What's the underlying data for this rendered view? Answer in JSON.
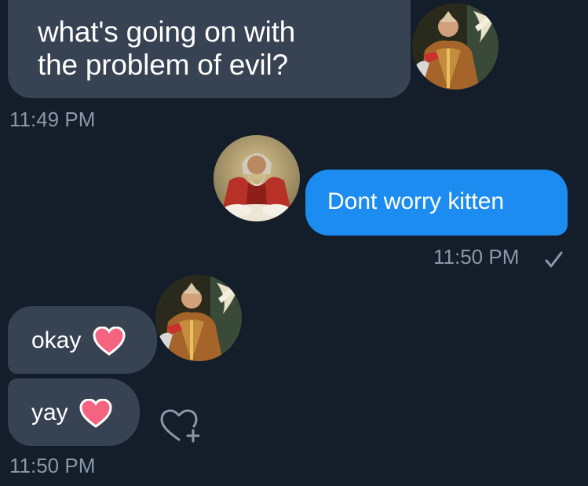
{
  "messages": [
    {
      "id": "m1",
      "side": "received",
      "lines": [
        "what's going on with",
        "the problem of evil?"
      ],
      "timestamp": "11:49 PM"
    },
    {
      "id": "m2",
      "side": "sent",
      "text": "Dont worry kitten",
      "timestamp": "11:50 PM",
      "status_icon": "check-icon"
    },
    {
      "id": "m3",
      "side": "received",
      "text": "okay",
      "emoji": "heart-icon"
    },
    {
      "id": "m4",
      "side": "received",
      "text": "yay",
      "emoji": "heart-icon",
      "timestamp": "11:50 PM"
    }
  ],
  "icons": {
    "react": "heart-plus-icon",
    "read_receipt": "check-icon"
  },
  "colors": {
    "background": "#141d2a",
    "received_bubble": "#374353",
    "sent_bubble": "#1d8cf0",
    "timestamp": "#8b98a5",
    "heart": "#f4637f"
  }
}
